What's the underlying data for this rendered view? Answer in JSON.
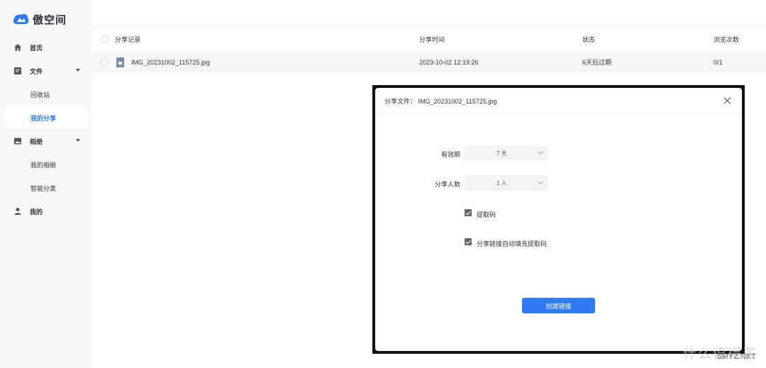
{
  "app": {
    "name": "傲空间",
    "brand_color": "#2f7bf5"
  },
  "sidebar": {
    "items": [
      {
        "label": "首页",
        "icon": "home-icon",
        "type": "top"
      },
      {
        "label": "文件",
        "icon": "file-icon",
        "type": "group"
      },
      {
        "label": "回收站",
        "type": "sub"
      },
      {
        "label": "我的分享",
        "type": "sub",
        "active": true
      },
      {
        "label": "相册",
        "icon": "image-icon",
        "type": "group"
      },
      {
        "label": "我的相册",
        "type": "sub"
      },
      {
        "label": "智能分类",
        "type": "sub"
      },
      {
        "label": "我的",
        "icon": "user-icon",
        "type": "top"
      }
    ]
  },
  "table": {
    "headers": {
      "name": "分享记录",
      "time": "分享时间",
      "status": "状态",
      "views": "浏览次数"
    },
    "rows": [
      {
        "name": "IMG_20231002_115725.jpg",
        "time": "2023-10-02 12:19:26",
        "status": "6天后过期",
        "views": "0/1"
      }
    ]
  },
  "modal": {
    "title": "分享文件：  IMG_20231002_115725.jpg",
    "validity_label": "有效期",
    "validity_value": "7 天",
    "people_label": "分享人数",
    "people_value": "1 人",
    "code_checkbox": "提取码",
    "code_checked": true,
    "autofill_checkbox": "分享链接自动填充提取码",
    "autofill_checked": true,
    "create_button": "创建链接"
  },
  "watermark": {
    "text": "什么值得买",
    "sub": "SMYZ.NET"
  }
}
